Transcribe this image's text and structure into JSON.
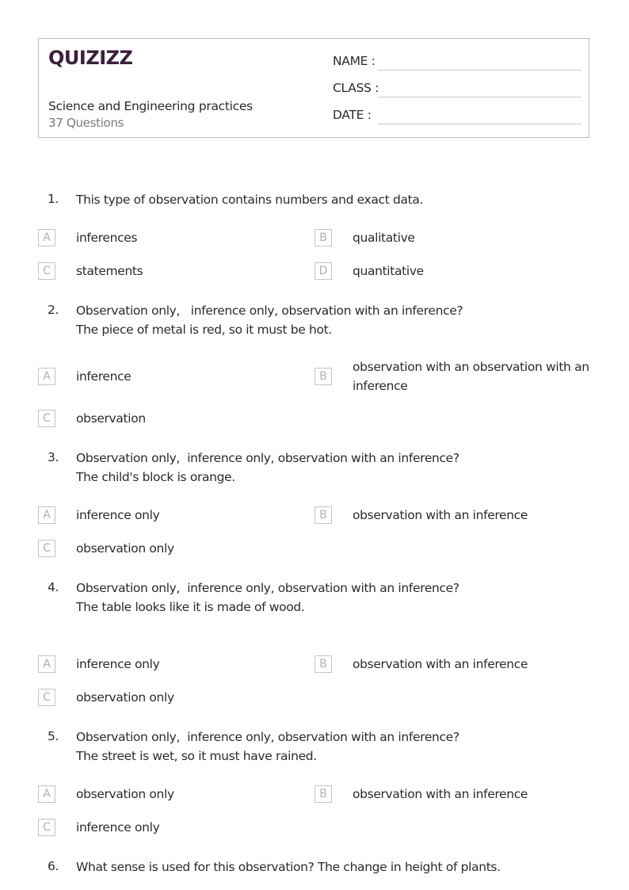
{
  "header": {
    "logo": "QUIZIZZ",
    "title": "Science and Engineering practices",
    "subtitle": "37 Questions",
    "fields": [
      {
        "label": "NAME :"
      },
      {
        "label": "CLASS :"
      },
      {
        "label": "DATE  :"
      }
    ]
  },
  "questions": [
    {
      "number": "1.",
      "text": "This type of observation contains numbers and exact data.",
      "options": [
        {
          "letter": "A",
          "text": "inferences"
        },
        {
          "letter": "B",
          "text": "qualitative"
        },
        {
          "letter": "C",
          "text": "statements"
        },
        {
          "letter": "D",
          "text": "quantitative"
        }
      ]
    },
    {
      "number": "2.",
      "text": "Observation only,   inference only, observation with an inference?\nThe piece of metal is red, so it must be hot.",
      "options": [
        {
          "letter": "A",
          "text": "inference"
        },
        {
          "letter": "B",
          "text": "observation with an observation with an inference"
        },
        {
          "letter": "C",
          "text": "observation"
        }
      ]
    },
    {
      "number": "3.",
      "text": "Observation only,  inference only, observation with an inference?\nThe child's block is orange.",
      "options": [
        {
          "letter": "A",
          "text": "inference only"
        },
        {
          "letter": "B",
          "text": "observation with an inference"
        },
        {
          "letter": "C",
          "text": "observation only"
        }
      ]
    },
    {
      "number": "4.",
      "text": "Observation only,  inference only, observation with an inference?\nThe table looks like it is made of wood.",
      "options": [
        {
          "letter": "A",
          "text": "inference only"
        },
        {
          "letter": "B",
          "text": "observation with an inference"
        },
        {
          "letter": "C",
          "text": "observation only"
        }
      ]
    },
    {
      "number": "5.",
      "text": "Observation only,  inference only, observation with an inference?\nThe street is wet, so it must have rained.",
      "options": [
        {
          "letter": "A",
          "text": "observation only"
        },
        {
          "letter": "B",
          "text": "observation with an inference"
        },
        {
          "letter": "C",
          "text": "inference only"
        }
      ]
    },
    {
      "number": "6.",
      "text": "What sense is used for this observation? The change in height of plants.",
      "options": []
    }
  ]
}
